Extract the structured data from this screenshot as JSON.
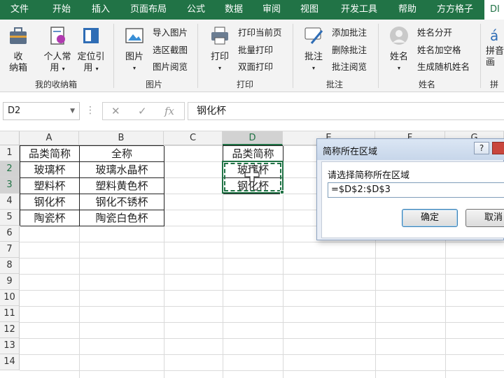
{
  "ribbon_tabs": [
    "文件",
    "开始",
    "插入",
    "页面布局",
    "公式",
    "数据",
    "审阅",
    "视图",
    "开发工具",
    "帮助",
    "方方格子",
    "DI"
  ],
  "active_tab_index": 11,
  "ribbon": {
    "group1": {
      "btn1": "收",
      "btn1b": "纳箱",
      "btn2": "个人常",
      "btn2b": "用",
      "btn3": "定位引",
      "btn3b": "用",
      "label": "我的收纳箱"
    },
    "group2": {
      "big": "图片",
      "small": [
        "导入图片",
        "选区截图",
        "图片阅览"
      ],
      "label": "图片"
    },
    "group3": {
      "big": "打印",
      "small": [
        "打印当前页",
        "批量打印",
        "双面打印"
      ],
      "label": "打印"
    },
    "group4": {
      "big": "批注",
      "small": [
        "添加批注",
        "删除批注",
        "批注阅览"
      ],
      "label": "批注"
    },
    "group5": {
      "big": "姓名",
      "small": [
        "姓名分开",
        "姓名加空格",
        "生成随机姓名"
      ],
      "label": "姓名"
    },
    "group6": {
      "big": "拼音",
      "big2": "画",
      "label": "拼"
    }
  },
  "formula_bar": {
    "name_box": "D2",
    "cancel": "✕",
    "enter": "✓",
    "fx": "fx",
    "content": "钢化杯"
  },
  "columns": [
    "A",
    "B",
    "C",
    "D",
    "E",
    "F",
    "G"
  ],
  "rows": [
    "1",
    "2",
    "3",
    "4",
    "5",
    "6",
    "7",
    "8",
    "9",
    "10",
    "11",
    "12",
    "13",
    "14"
  ],
  "table_ab": {
    "header": [
      "品类简称",
      "全称"
    ],
    "rows": [
      [
        "玻璃杯",
        "玻璃水晶杯"
      ],
      [
        "塑料杯",
        "塑料黄色杯"
      ],
      [
        "钢化杯",
        "钢化不锈杯"
      ],
      [
        "陶瓷杯",
        "陶瓷白色杯"
      ]
    ]
  },
  "table_d": {
    "header": "品类简称",
    "rows": [
      "玻璃杯",
      "钢化杯"
    ]
  },
  "dialog": {
    "title": "简称所在区域",
    "help": "?",
    "prompt": "请选择简称所在区域",
    "value": "=$D$2:$D$3",
    "ok": "确定",
    "cancel": "取消"
  },
  "colors": {
    "accent": "#217346",
    "selection": "#217346"
  }
}
